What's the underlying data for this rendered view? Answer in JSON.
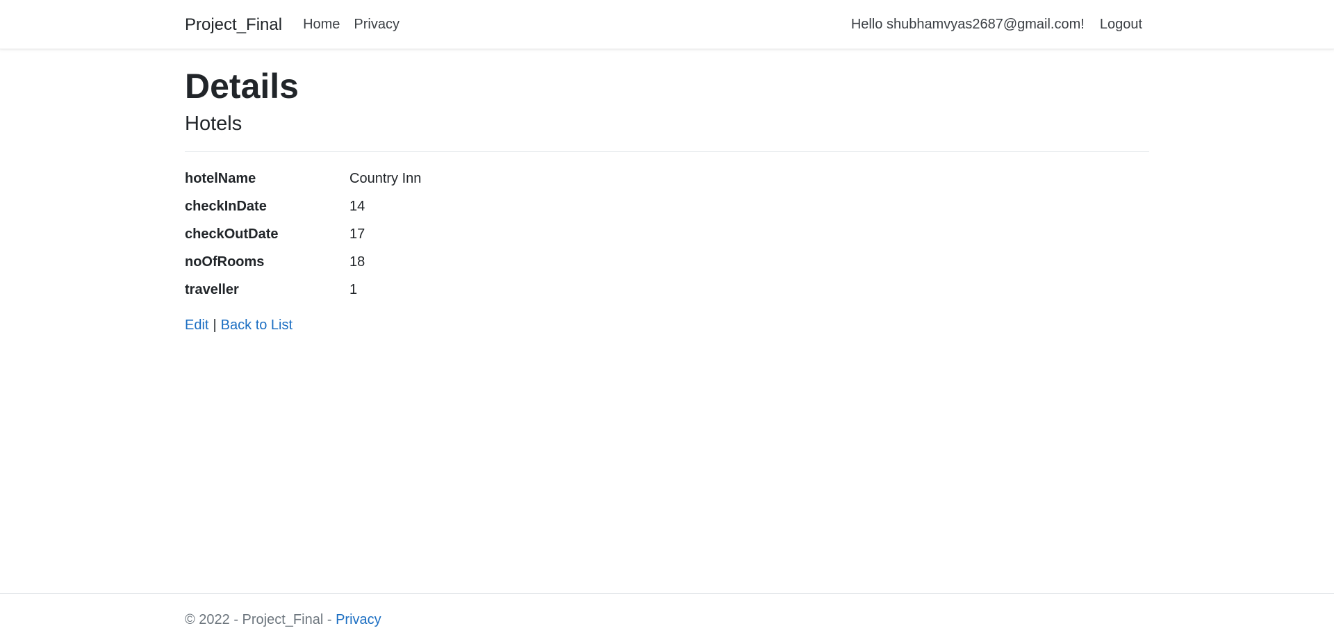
{
  "nav": {
    "brand": "Project_Final",
    "links": [
      "Home",
      "Privacy"
    ],
    "greeting": "Hello shubhamvyas2687@gmail.com!",
    "logout": "Logout"
  },
  "page": {
    "title": "Details",
    "subtitle": "Hotels"
  },
  "details": [
    {
      "label": "hotelName",
      "value": "Country Inn"
    },
    {
      "label": "checkInDate",
      "value": "14"
    },
    {
      "label": "checkOutDate",
      "value": "17"
    },
    {
      "label": "noOfRooms",
      "value": "18"
    },
    {
      "label": "traveller",
      "value": "1"
    }
  ],
  "actions": {
    "edit": "Edit",
    "separator": "|",
    "back": "Back to List"
  },
  "footer": {
    "copyright": "© 2022 - Project_Final - ",
    "privacy": "Privacy"
  },
  "colors": {
    "link": "#1b6ec2",
    "text": "#212529",
    "muted": "#6c757d"
  }
}
